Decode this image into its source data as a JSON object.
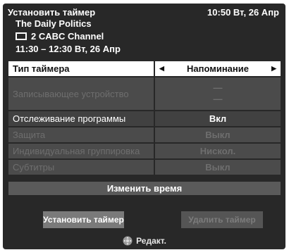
{
  "header": {
    "title": "Установить таймер",
    "time": "10:50 Вт, 26 Апр",
    "program_title": "The Daily Politics",
    "channel": "2 CABC Channel",
    "program_time": "11:30 – 12:30 Вт, 26 Апр"
  },
  "rows": [
    {
      "label": "Тип таймера",
      "value": "Напоминание",
      "state": "selected"
    },
    {
      "label": "Записывающее устройство",
      "value_lines": [
        "—",
        "—"
      ],
      "state": "disabled"
    },
    {
      "label": "Отслеживание программы",
      "value": "Вкл",
      "state": "normal"
    },
    {
      "label": "Защита",
      "value": "Выкл",
      "state": "disabled"
    },
    {
      "label": "Индивидуальная группировка",
      "value": "Нискол.",
      "state": "disabled"
    },
    {
      "label": "Субтитры",
      "value": "Выкл",
      "state": "disabled"
    }
  ],
  "change_time_label": "Изменить время",
  "buttons": {
    "set_timer": "Установить таймер",
    "delete_timer": "Удалить таймер"
  },
  "footer": {
    "label": "Редакт.",
    "icon": "dpad-icon"
  },
  "colors": {
    "panel_bg": "#282828",
    "row_bg": "#414141",
    "selected_bg": "#ffffff",
    "disabled_text": "#6e6e6e"
  }
}
